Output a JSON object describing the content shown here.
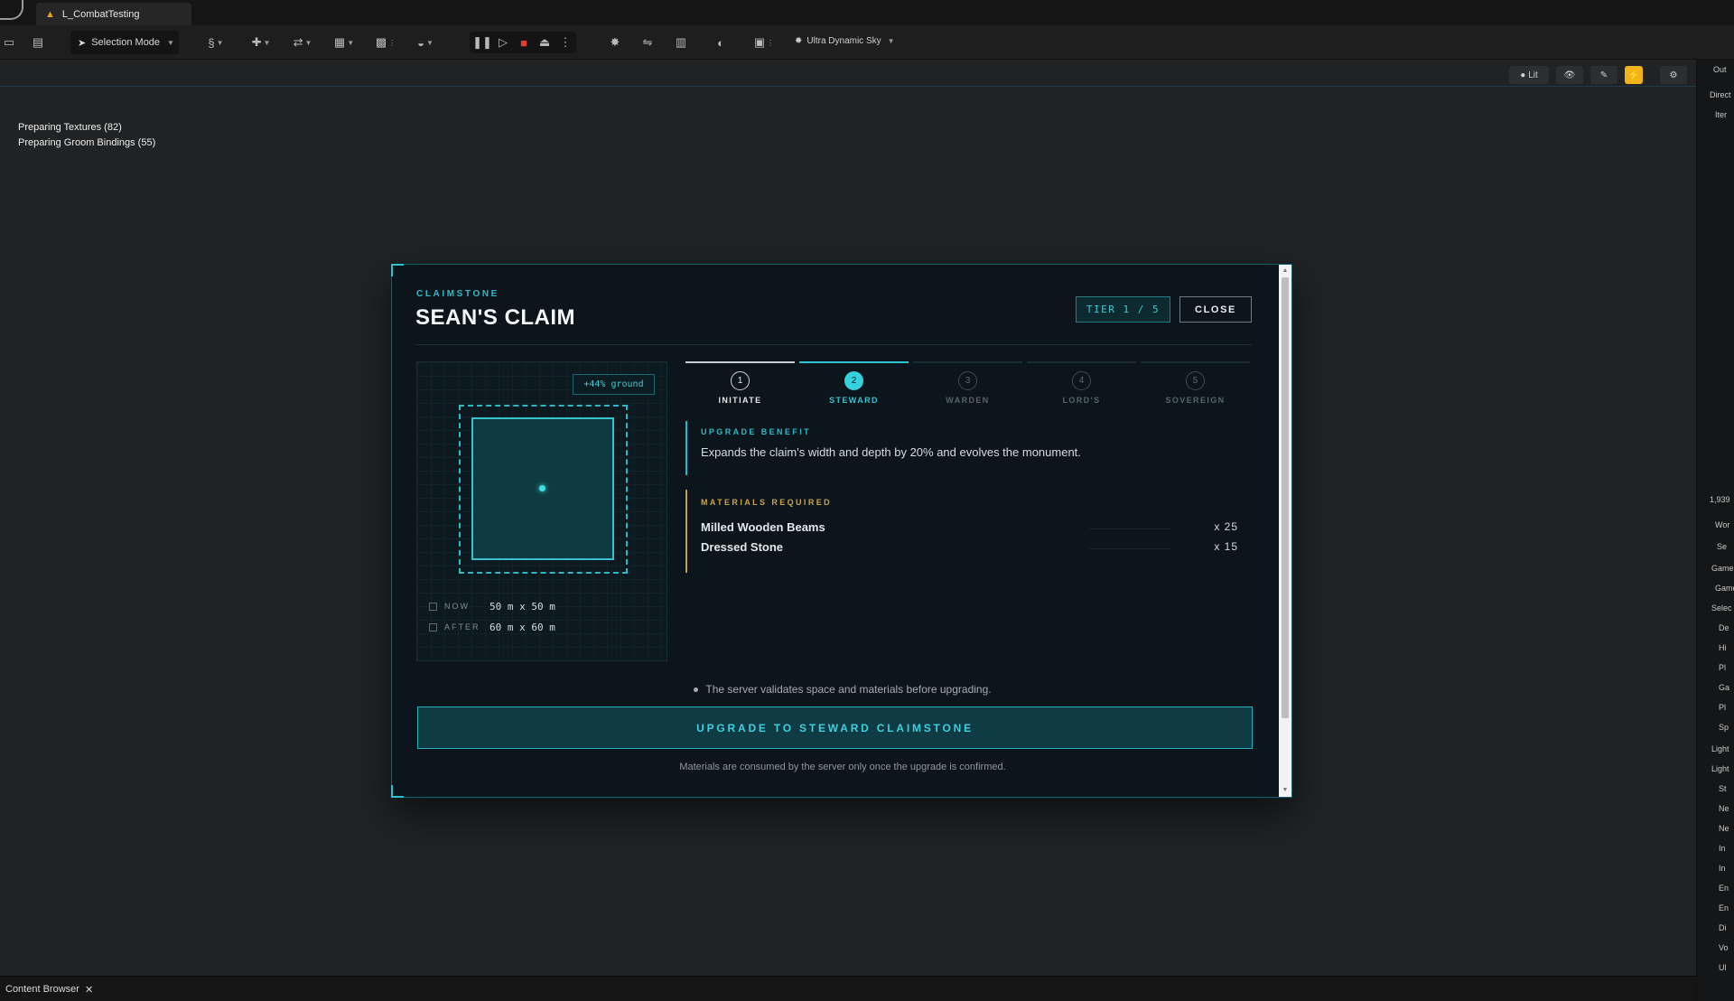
{
  "editor": {
    "level_tab": "L_CombatTesting",
    "selection_mode": "Selection Mode",
    "sky_label": "Ultra Dynamic Sky",
    "viewport_mode": "Lit",
    "stats": [
      "Preparing Textures (82)",
      "Preparing Groom Bindings (55)"
    ],
    "content_browser": "Content Browser",
    "right_panel_rows": [
      "Out",
      "Direct",
      "Iter",
      "1,939",
      "Wor",
      "Se",
      "Game",
      "Game",
      "Selec",
      "De",
      "Hi",
      "Pl",
      "Ga",
      "Pl",
      "Sp",
      "Light",
      "Light",
      "St",
      "Ne",
      "Ne",
      "In",
      "In",
      "En",
      "En",
      "Di",
      "Vo",
      "Ul"
    ]
  },
  "claim": {
    "eyebrow": "CLAIMSTONE",
    "title": "SEAN'S CLAIM",
    "tier_badge": "TIER 1 / 5",
    "close_label": "CLOSE",
    "ground_tag": "+44% ground",
    "now_label": "NOW",
    "now_value": "50 m x 50 m",
    "after_label": "AFTER",
    "after_value": "60 m x 60 m",
    "steps": [
      {
        "num": "1",
        "label": "INITIATE",
        "state": "done"
      },
      {
        "num": "2",
        "label": "STEWARD",
        "state": "active"
      },
      {
        "num": "3",
        "label": "WARDEN",
        "state": "locked"
      },
      {
        "num": "4",
        "label": "LORD'S",
        "state": "locked"
      },
      {
        "num": "5",
        "label": "SOVEREIGN",
        "state": "locked"
      }
    ],
    "benefit_heading": "UPGRADE BENEFIT",
    "benefit_text": "Expands the claim's width and depth by 20% and evolves the monument.",
    "materials_heading": "MATERIALS REQUIRED",
    "materials": [
      {
        "name": "Milled Wooden Beams",
        "qty": "x 25"
      },
      {
        "name": "Dressed Stone",
        "qty": "x 15"
      }
    ],
    "note": "The server validates space and materials before upgrading.",
    "upgrade_label": "UPGRADE TO STEWARD CLAIMSTONE",
    "footnote": "Materials are consumed by the server only once the upgrade is confirmed.",
    "colors": {
      "accent": "#2ec5d2",
      "materials_accent": "#c19d47",
      "panel_bg": "#0b151b"
    }
  }
}
